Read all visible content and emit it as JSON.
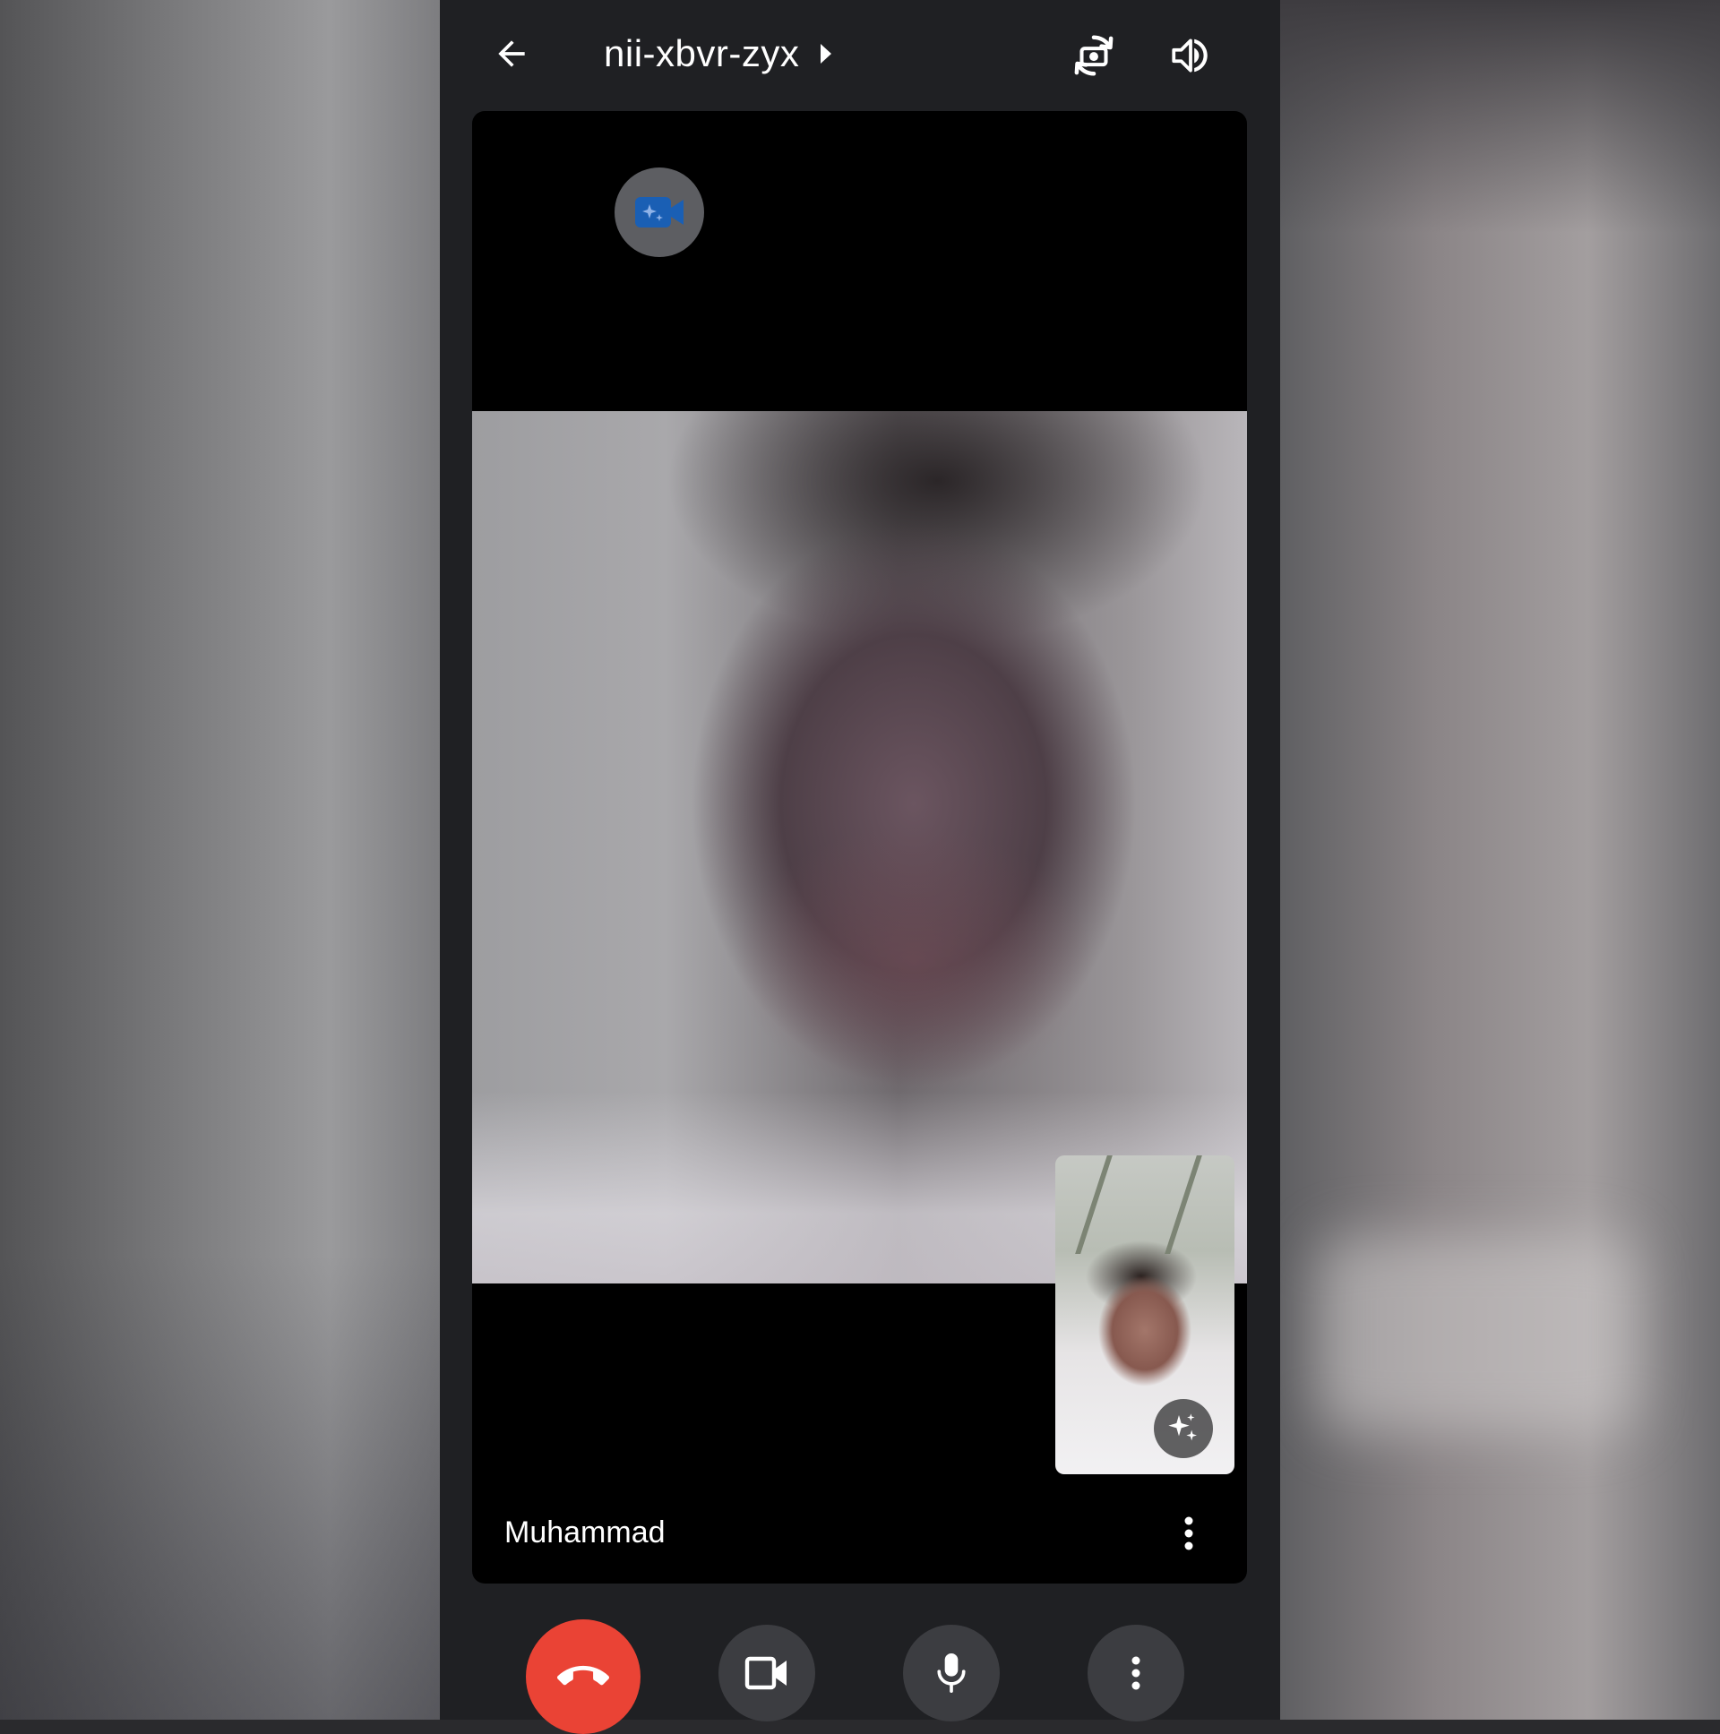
{
  "meeting": {
    "code": "nii-xbvr-zyx"
  },
  "participant": {
    "name": "Muhammad"
  },
  "icons": {
    "back": "arrow-left-icon",
    "title_caret": "caret-right-icon",
    "switch_camera": "switch-camera-icon",
    "speaker": "speaker-icon",
    "effects": "video-effects-icon",
    "sparkle": "sparkle-icon",
    "tile_more": "more-vert-icon",
    "hangup": "hang-up-icon",
    "camera": "camera-icon",
    "mic": "microphone-icon",
    "more": "more-vert-icon"
  },
  "colors": {
    "hangup": "#ea4335",
    "effects_accent": "#1a5fb4",
    "control_bg": "#3c3d41",
    "bar_bg": "#1f2023"
  }
}
